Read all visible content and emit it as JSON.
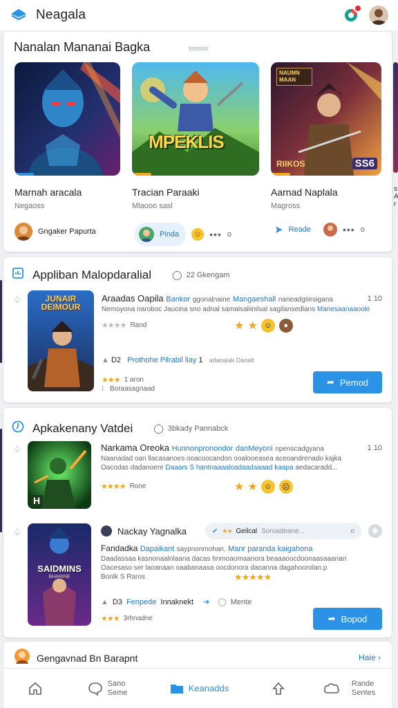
{
  "header": {
    "title": "Neagala"
  },
  "featured": {
    "title": "Nanalan Mananai Bagka",
    "hint": "ssosos",
    "items": [
      {
        "name": "Marnah aracala",
        "sub": "Negaoss"
      },
      {
        "name": "Tracian Paraaki",
        "sub": "Mlaooo sasl"
      },
      {
        "name": "Aarnad Naplala",
        "sub": "Magross"
      }
    ],
    "game_art_text": {
      "item2": "MPEKLIS",
      "item3_top": "NAUMN MAAN",
      "item3_bottom": "RIIKOS",
      "item3_num": "SS6"
    },
    "dev_row": {
      "dev1_name": "Gngaker Papurta",
      "pill_label": "Pinda",
      "dots1": "•••",
      "dots1_end": "o",
      "read_label": "Reade",
      "dots2": "•••",
      "dots2_end": "o"
    }
  },
  "section1": {
    "title": "Appliban Malopdaralial",
    "meta": "22 Gkengam",
    "side_num": "1 10",
    "thumb_text": "JUNAIR DEIMOUR",
    "row_title": "Araadas Oapila",
    "row_title_hl": "Bankor",
    "row_title_rest": "ggonalnaine",
    "row_title_hl2": "Mangaeshall",
    "row_title_muted": "naneadgtiesigana",
    "row_text1": "Nemoyona naroboc Jaucina sno adnal samalsaliinilsal sagilansedlans",
    "row_text1_b": "Manesaanaaooki",
    "stat_rating": "Rand",
    "chip1_line": "D2",
    "chip1_hl": "Prothohe Pilrabil liay",
    "chip1_tail": "1",
    "chip1_muted": "adaoaiak Daoalt",
    "stars_label": "1 aron",
    "small_line": "Boraasagnaad",
    "button": "Pemod"
  },
  "section2": {
    "title": "Apkakenany Vatdei",
    "meta": "3bkady Pannabck",
    "side_num": "1 10",
    "item1": {
      "thumb_text": "H",
      "title": "Narkama Oreoka",
      "title_hl": "Hunnonpronondor",
      "title_hl2": "danMeyoni",
      "title_muted": "npenscadgyana",
      "text1": "Naanadad oan llacasanoes ooacoocandon ooalooeasea aceoandrenado kajka",
      "text2": "Oacodas dadanoere",
      "text2_b": "Daaars S",
      "text2_rest": "hantnaaaaloadaadaaaad kaapa",
      "text2_end": "aedacaradd...",
      "stars_label": "Rone"
    },
    "item2": {
      "thumb_text": "SAIDMINS",
      "thumb_sub": "BHARINE",
      "title": "Nackay Yagnalka",
      "chip_text": "Geilcal",
      "chip_muted": "Soroadeane...",
      "chip_end": "o",
      "line2": "Fandadka",
      "line2_b": "Dapaikant",
      "line2_mid": "saypnonmohan.",
      "line2_b2": "Manr paranda kaigahona",
      "text1": "Daadassaa kasnonaalnlaana dacas hnmoaomaanora beaaaoocdoonaasaaanan",
      "text2": "Oacesaso ser laoanaan oaabanaasa oocdonora daoanna dagahoorolan.p",
      "text3": "Bonlk S Raros",
      "chip2_line": "D3",
      "chip2_hl": "Fenpede",
      "chip2_rest": "Innaknekt",
      "chip2_menu": "Mente",
      "stars_label": "3rhnadne",
      "button": "Bopod"
    }
  },
  "bottom": {
    "title": "Gengavnad Bn Barapnt",
    "more": "Haie",
    "nav": [
      {
        "label_top": "",
        "label_bottom": ""
      },
      {
        "label_top": "Sano",
        "label_bottom": "Seme"
      },
      {
        "label_top": "Keanadds",
        "label_bottom": ""
      },
      {
        "label_top": "",
        "label_bottom": ""
      },
      {
        "label_top": "Rande",
        "label_bottom": "Sentes"
      }
    ]
  },
  "colors": {
    "accent": "#2c92e6",
    "star": "#f1a61a",
    "badge": "#e52a33"
  }
}
